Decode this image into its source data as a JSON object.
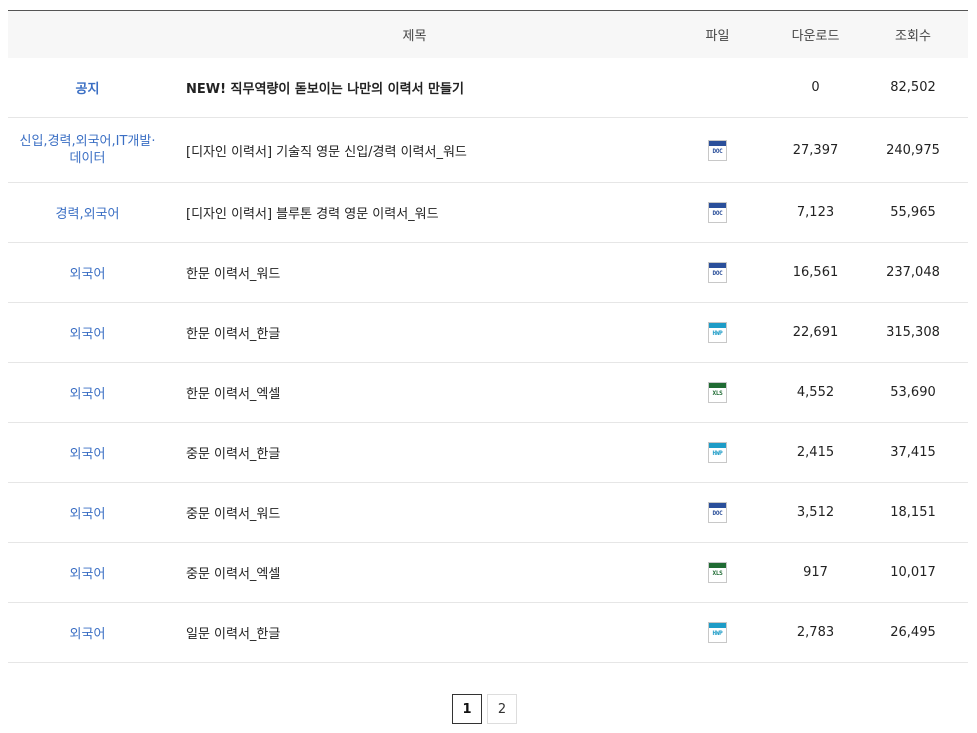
{
  "header": {
    "title_label": "제목",
    "file_label": "파일",
    "downloads_label": "다운로드",
    "views_label": "조회수"
  },
  "rows": [
    {
      "category": "공지",
      "title": "NEW! 직무역량이 돋보이는 나만의 이력서 만들기",
      "file": "",
      "file_type": "none",
      "downloads": "0",
      "views": "82,502",
      "notice": true
    },
    {
      "category": "신입,경력,외국어,IT개발·데이터",
      "title": "[디자인 이력서] 기술직 영문 신입/경력 이력서_워드",
      "file": "DOC",
      "file_type": "doc",
      "downloads": "27,397",
      "views": "240,975"
    },
    {
      "category": "경력,외국어",
      "title": "[디자인 이력서] 블루톤 경력 영문 이력서_워드",
      "file": "DOC",
      "file_type": "doc",
      "downloads": "7,123",
      "views": "55,965"
    },
    {
      "category": "외국어",
      "title": "한문 이력서_워드",
      "file": "DOC",
      "file_type": "doc",
      "downloads": "16,561",
      "views": "237,048"
    },
    {
      "category": "외국어",
      "title": "한문 이력서_한글",
      "file": "HWP",
      "file_type": "hwp",
      "downloads": "22,691",
      "views": "315,308"
    },
    {
      "category": "외국어",
      "title": "한문 이력서_엑셀",
      "file": "XLS",
      "file_type": "xls",
      "downloads": "4,552",
      "views": "53,690"
    },
    {
      "category": "외국어",
      "title": "중문 이력서_한글",
      "file": "HWP",
      "file_type": "hwp",
      "downloads": "2,415",
      "views": "37,415"
    },
    {
      "category": "외국어",
      "title": "중문 이력서_워드",
      "file": "DOC",
      "file_type": "doc",
      "downloads": "3,512",
      "views": "18,151"
    },
    {
      "category": "외국어",
      "title": "중문 이력서_엑셀",
      "file": "XLS",
      "file_type": "xls",
      "downloads": "917",
      "views": "10,017"
    },
    {
      "category": "외국어",
      "title": "일문 이력서_한글",
      "file": "HWP",
      "file_type": "hwp",
      "downloads": "2,783",
      "views": "26,495"
    }
  ],
  "pagination": {
    "pages": [
      "1",
      "2"
    ],
    "current": "1"
  },
  "colors": {
    "category_link": "#3b6fc4",
    "doc": "#2a4f9a",
    "hwp": "#1e9cc7",
    "xls": "#1f6b33"
  }
}
